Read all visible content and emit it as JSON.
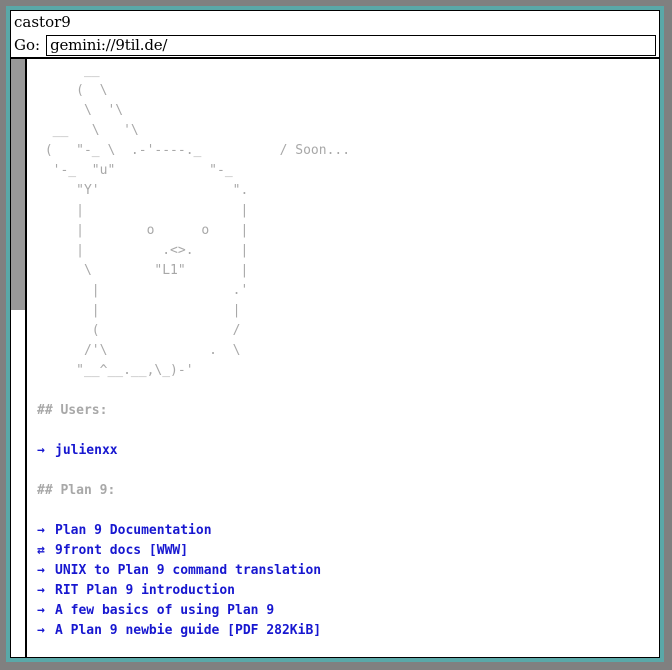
{
  "window": {
    "title": "castor9",
    "frame_color": "#808080",
    "accent_color": "#5aa8a8"
  },
  "toolbar": {
    "go_label": "Go:",
    "url_value": "gemini://9til.de/",
    "url_placeholder": "gemini://"
  },
  "scrollbar": {
    "thumb_top_pct": 0,
    "thumb_height_pct": 42
  },
  "page": {
    "ascii_art": "      __\n     (  \\\n      \\  '\\\n  __   \\   '\\\n (   \"-_ \\  .-'----._          / Soon...\n  '-_  \"u\"            \"-_\n     \"Y'                 \".\n     |                    |\n     |        o      o    |\n     |          .<>.      |\n      \\        \"L1\"       |\n       |                 .'\n       |                 |\n       (                 /\n      /'\\             .  \\\n     \"__^__.__,\\_)-'",
    "sections": [
      {
        "heading": "## Users:",
        "links": [
          {
            "arrow": "→",
            "label": "julienxx",
            "kind": "gemini"
          }
        ]
      },
      {
        "heading": "## Plan 9:",
        "links": [
          {
            "arrow": "→",
            "label": "Plan 9 Documentation",
            "kind": "gemini"
          },
          {
            "arrow": "⇄",
            "label": "9front docs [WWW]",
            "kind": "web"
          },
          {
            "arrow": "→",
            "label": "UNIX to Plan 9 command translation",
            "kind": "gemini"
          },
          {
            "arrow": "→",
            "label": "RIT Plan 9 introduction",
            "kind": "gemini"
          },
          {
            "arrow": "→",
            "label": "A few basics of using Plan 9",
            "kind": "gemini"
          },
          {
            "arrow": "→",
            "label": "A Plan 9 newbie guide [PDF 282KiB]",
            "kind": "gemini"
          }
        ]
      }
    ],
    "colors": {
      "link": "#1717d0",
      "heading": "#a8a8a8",
      "ascii": "#a8a8a8"
    }
  }
}
